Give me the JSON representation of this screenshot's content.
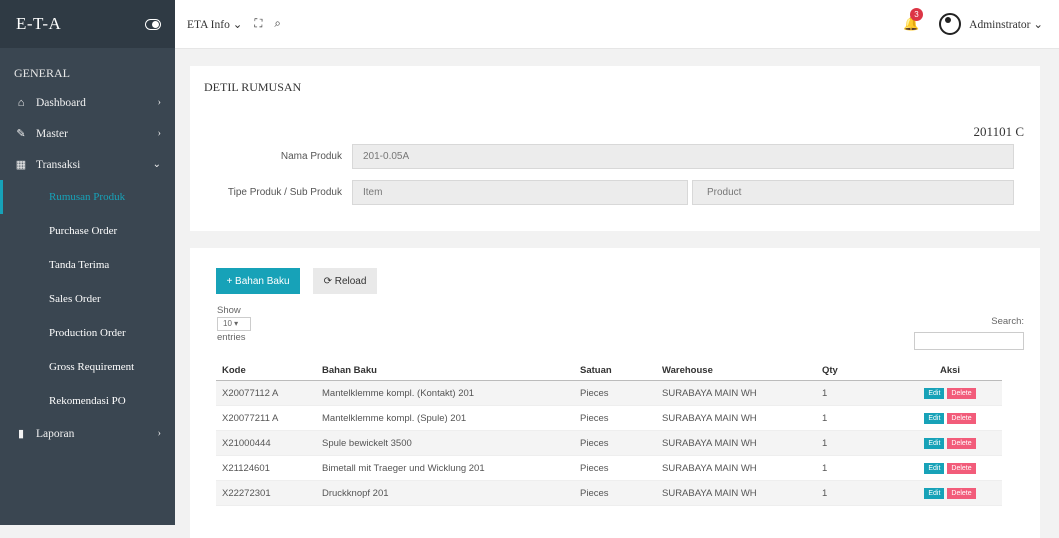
{
  "brand": "E-T-A",
  "sidebar": {
    "group": "GENERAL",
    "items": [
      {
        "label": "Dashboard",
        "icon": "home-icon",
        "glyph": "⌂",
        "chev": "›"
      },
      {
        "label": "Master",
        "icon": "edit-icon",
        "glyph": "✎",
        "chev": "›"
      },
      {
        "label": "Transaksi",
        "icon": "grid-icon",
        "glyph": "▦",
        "chev": "⌄"
      }
    ],
    "subitems": [
      "Rumusan Produk",
      "Purchase Order",
      "Tanda Terima",
      "Sales Order",
      "Production Order",
      "Gross Requirement",
      "Rekomendasi PO"
    ],
    "laporan": {
      "label": "Laporan",
      "icon": "bar-chart-icon",
      "glyph": "▮",
      "chev": "›"
    }
  },
  "topbar": {
    "menu": "ETA Info ⌄",
    "expand_glyph": "⛶",
    "search_glyph": "⌕",
    "notif_count": "3",
    "user": "Adminstrator ⌄"
  },
  "detail": {
    "title": "DETIL RUMUSAN",
    "code": "201101 C",
    "nama_label": "Nama Produk",
    "nama_value": "201-0.05A",
    "tipe_label": "Tipe Produk / Sub Produk",
    "tipe_value": "Item",
    "sub_value": "Product"
  },
  "list": {
    "add_label": "+ Bahan Baku",
    "reload_label": "⟳ Reload",
    "show_label": "Show",
    "entries_value": "10 ▾",
    "entries_label": "entries",
    "search_label": "Search:",
    "columns": [
      "Kode",
      "Bahan Baku",
      "Satuan",
      "Warehouse",
      "Qty",
      "Aksi"
    ],
    "rows": [
      [
        "X20077112 A",
        "Mantelklemme kompl. (Kontakt) 201",
        "Pieces",
        "SURABAYA MAIN WH",
        "1"
      ],
      [
        "X20077211 A",
        "Mantelklemme kompl. (Spule) 201",
        "Pieces",
        "SURABAYA MAIN WH",
        "1"
      ],
      [
        "X21000444",
        "Spule bewickelt 3500",
        "Pieces",
        "SURABAYA MAIN WH",
        "1"
      ],
      [
        "X21124601",
        "Bimetall mit Traeger und Wicklung 201",
        "Pieces",
        "SURABAYA MAIN WH",
        "1"
      ],
      [
        "X22272301",
        "Druckknopf 201",
        "Pieces",
        "SURABAYA MAIN WH",
        "1"
      ]
    ],
    "edit_label": "Edit",
    "delete_label": "Delete"
  },
  "colors": {
    "sidebar": "#3a4651",
    "accent": "#17a2b8",
    "danger": "#f25c7a"
  }
}
